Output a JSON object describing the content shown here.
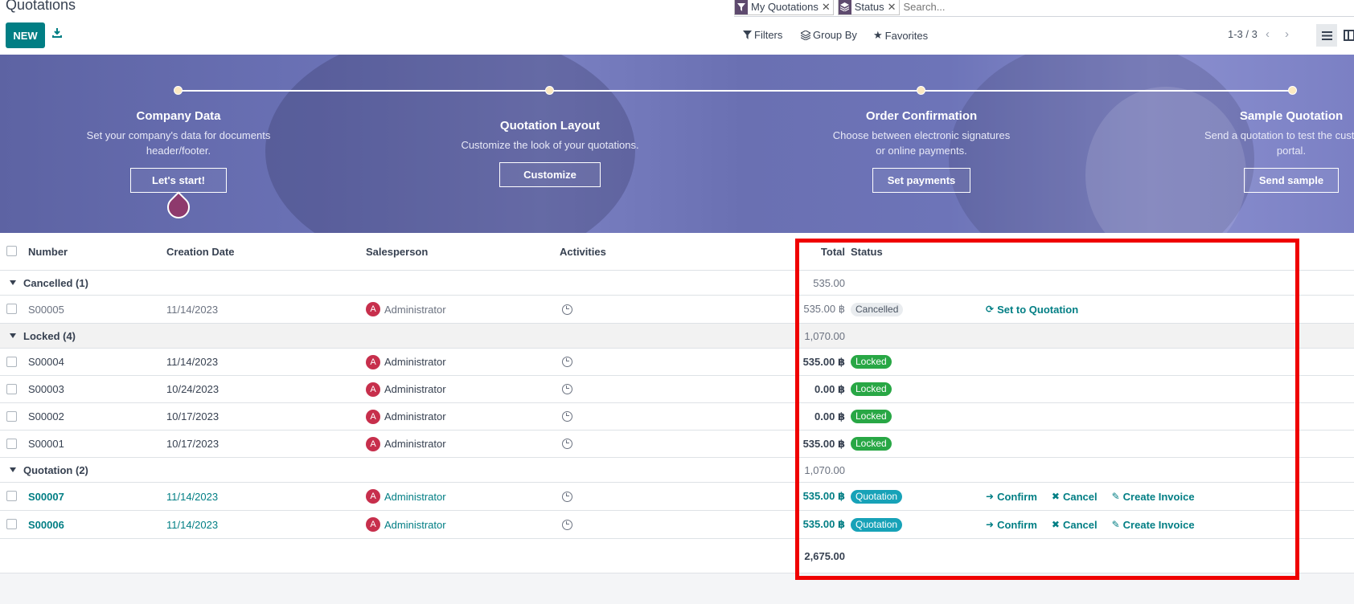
{
  "page": {
    "title": "Quotations"
  },
  "toolbar": {
    "new_label": "NEW",
    "download_icon": "download-icon"
  },
  "search": {
    "facets": [
      {
        "icon": "filter-icon",
        "label": "My Quotations"
      },
      {
        "icon": "layers-icon",
        "label": "Status"
      }
    ],
    "placeholder": "Search..."
  },
  "filters": {
    "filters_label": "Filters",
    "groupby_label": "Group By",
    "favorites_label": "Favorites"
  },
  "pager": {
    "text": "1-3 / 3"
  },
  "onboarding": {
    "steps": [
      {
        "title": "Company Data",
        "desc": "Set your company's data for documents header/footer.",
        "button": "Let's start!"
      },
      {
        "title": "Quotation Layout",
        "desc": "Customize the look of your quotations.",
        "button": "Customize"
      },
      {
        "title": "Order Confirmation",
        "desc": "Choose between electronic signatures or online payments.",
        "button": "Set payments"
      },
      {
        "title": "Sample Quotation",
        "desc": "Send a quotation to test the customer portal.",
        "button": "Send sample"
      }
    ]
  },
  "table": {
    "headers": {
      "number": "Number",
      "date": "Creation Date",
      "salesperson": "Salesperson",
      "activities": "Activities",
      "total": "Total",
      "status": "Status"
    },
    "groups": [
      {
        "label": "Cancelled (1)",
        "total": "535.00",
        "rows": [
          {
            "number": "S00005",
            "date": "11/14/2023",
            "salesperson": "Administrator",
            "avatar": "A",
            "total": "535.00 ฿",
            "status": "Cancelled",
            "actions": [
              "Set to Quotation"
            ]
          }
        ]
      },
      {
        "label": "Locked (4)",
        "total": "1,070.00",
        "rows": [
          {
            "number": "S00004",
            "date": "11/14/2023",
            "salesperson": "Administrator",
            "avatar": "A",
            "total": "535.00 ฿",
            "status": "Locked"
          },
          {
            "number": "S00003",
            "date": "10/24/2023",
            "salesperson": "Administrator",
            "avatar": "A",
            "total": "0.00 ฿",
            "status": "Locked"
          },
          {
            "number": "S00002",
            "date": "10/17/2023",
            "salesperson": "Administrator",
            "avatar": "A",
            "total": "0.00 ฿",
            "status": "Locked"
          },
          {
            "number": "S00001",
            "date": "10/17/2023",
            "salesperson": "Administrator",
            "avatar": "A",
            "total": "535.00 ฿",
            "status": "Locked"
          }
        ]
      },
      {
        "label": "Quotation (2)",
        "total": "1,070.00",
        "rows": [
          {
            "number": "S00007",
            "date": "11/14/2023",
            "salesperson": "Administrator",
            "avatar": "A",
            "total": "535.00 ฿",
            "status": "Quotation",
            "actions": [
              "Confirm",
              "Cancel",
              "Create Invoice"
            ]
          },
          {
            "number": "S00006",
            "date": "11/14/2023",
            "salesperson": "Administrator",
            "avatar": "A",
            "total": "535.00 ฿",
            "status": "Quotation",
            "actions": [
              "Confirm",
              "Cancel",
              "Create Invoice"
            ]
          }
        ]
      }
    ],
    "grand_total": "2,675.00"
  },
  "colors": {
    "primary": "#017e84",
    "locked": "#28a745",
    "quotation": "#17a2b8",
    "highlight": "#ef0000",
    "avatar": "#c72f4c"
  }
}
